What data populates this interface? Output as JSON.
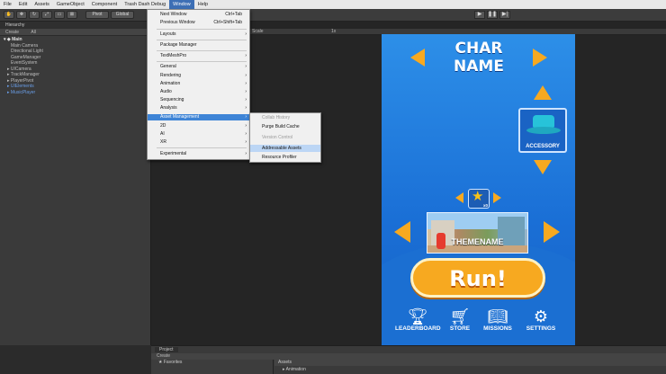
{
  "menubar": [
    "File",
    "Edit",
    "Assets",
    "GameObject",
    "Component",
    "Trash Dash Debug",
    "Window",
    "Help"
  ],
  "menubar_active": "Window",
  "toolbar": {
    "pivot": "Pivot",
    "global": "Global"
  },
  "hierarchy": {
    "tab": "Hierarchy",
    "create": "Create",
    "search": "All",
    "scene": "Main",
    "items": [
      "Main Camera",
      "Directional Light",
      "GameManager",
      "EventSystem",
      "UICamera",
      "TrackManager",
      "PlayerPivot",
      "UIElements",
      "MusicPlayer"
    ]
  },
  "game_toolbar": {
    "scale_label": "Scale",
    "scale_value": "1x"
  },
  "window_menu": {
    "items": [
      {
        "label": "Next Window",
        "shortcut": "Ctrl+Tab"
      },
      {
        "label": "Previous Window",
        "shortcut": "Ctrl+Shift+Tab"
      },
      {
        "label": "Layouts"
      },
      {
        "label": "Package Manager"
      },
      {
        "label": "TextMeshPro"
      },
      {
        "label": "General"
      },
      {
        "label": "Rendering"
      },
      {
        "label": "Animation"
      },
      {
        "label": "Audio"
      },
      {
        "label": "Sequencing"
      },
      {
        "label": "Analysis"
      },
      {
        "label": "Asset Management"
      },
      {
        "label": "2D"
      },
      {
        "label": "AI"
      },
      {
        "label": "XR"
      },
      {
        "label": "Experimental"
      }
    ],
    "highlighted": "Asset Management"
  },
  "submenu": {
    "items": [
      "Collab History",
      "Purge Build Cache",
      "Version Control",
      "Addressable Assets",
      "Resource Profiler"
    ],
    "highlighted": "Addressable Assets"
  },
  "game": {
    "char_title": "CHAR NAME",
    "accessory_label": "ACCESSORY",
    "star_count": "x0",
    "theme_name": "THEMENAME",
    "run_label": "Run!",
    "bottom": [
      {
        "icon": "trophy-icon",
        "label": "LEADERBOARD"
      },
      {
        "icon": "cart-icon",
        "label": "STORE"
      },
      {
        "icon": "book-icon",
        "label": "MISSIONS"
      },
      {
        "icon": "gear-icon",
        "label": "SETTINGS"
      }
    ]
  },
  "project": {
    "tab": "Project",
    "create": "Create",
    "favorites": "Favorites",
    "assets": "Assets",
    "folder": "Animation"
  },
  "colors": {
    "menu_highlight": "#3e84d6",
    "game_bg": "#2d8fe8",
    "run_button": "#f7a920",
    "arrow": "#f7a920"
  }
}
